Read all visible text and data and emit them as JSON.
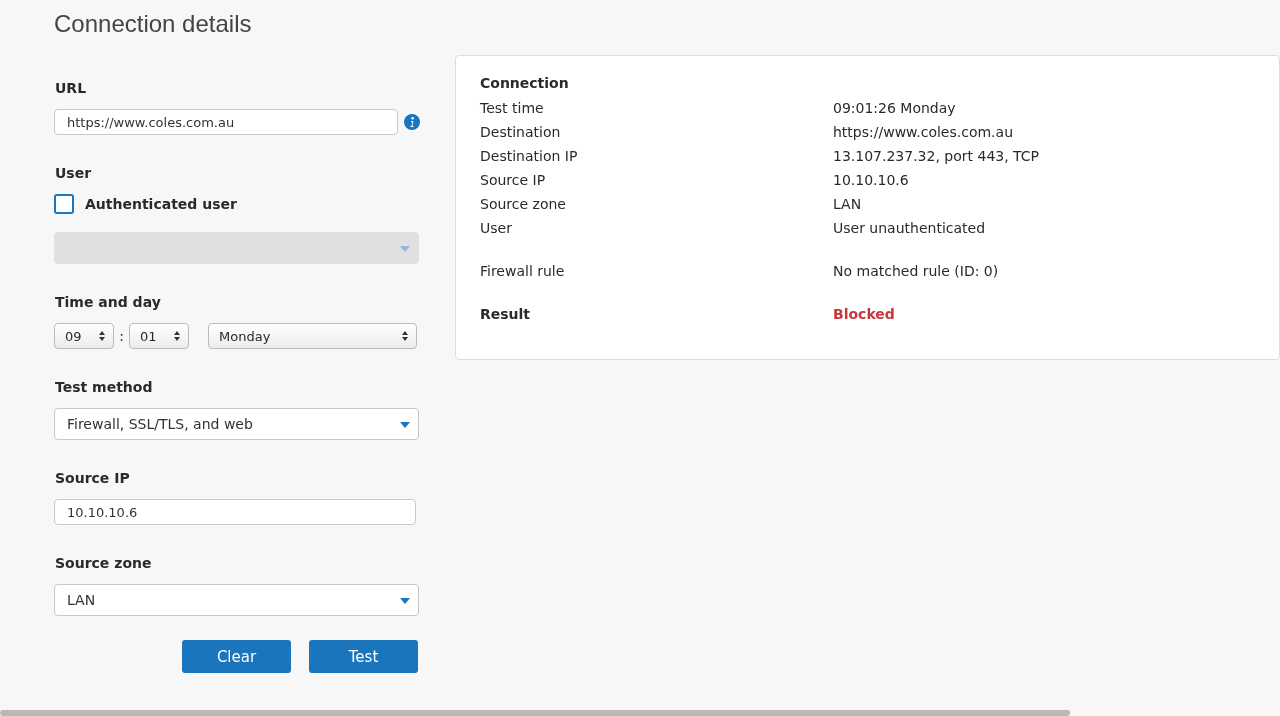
{
  "page": {
    "title": "Connection details"
  },
  "form": {
    "url": {
      "label": "URL",
      "value": "https://www.coles.com.au"
    },
    "user": {
      "label": "User",
      "checkbox": {
        "label": "Authenticated user",
        "checked": false
      },
      "dropdown": {
        "disabled": true
      }
    },
    "time_and_day": {
      "label": "Time and day",
      "hour": "09",
      "separator": ":",
      "minute": "01",
      "day": "Monday"
    },
    "test_method": {
      "label": "Test method",
      "value": "Firewall, SSL/TLS, and web"
    },
    "source_ip": {
      "label": "Source IP",
      "value": "10.10.10.6"
    },
    "source_zone": {
      "label": "Source zone",
      "value": "LAN"
    },
    "buttons": [
      "Clear",
      "Test"
    ]
  },
  "results": {
    "heading": "Connection",
    "groups": [
      [
        {
          "label": "Test time",
          "value": "09:01:26 Monday"
        },
        {
          "label": "Destination",
          "value": "https://www.coles.com.au"
        },
        {
          "label": "Destination IP",
          "value": "13.107.237.32, port 443, TCP"
        },
        {
          "label": "Source IP",
          "value": "10.10.10.6"
        },
        {
          "label": "Source zone",
          "value": "LAN"
        },
        {
          "label": "User",
          "value": "User unauthenticated"
        }
      ],
      [
        {
          "label": "Firewall rule",
          "value": "No matched rule (ID: 0)"
        }
      ]
    ],
    "result": {
      "label": "Result",
      "value": "Blocked",
      "alert": true
    }
  }
}
